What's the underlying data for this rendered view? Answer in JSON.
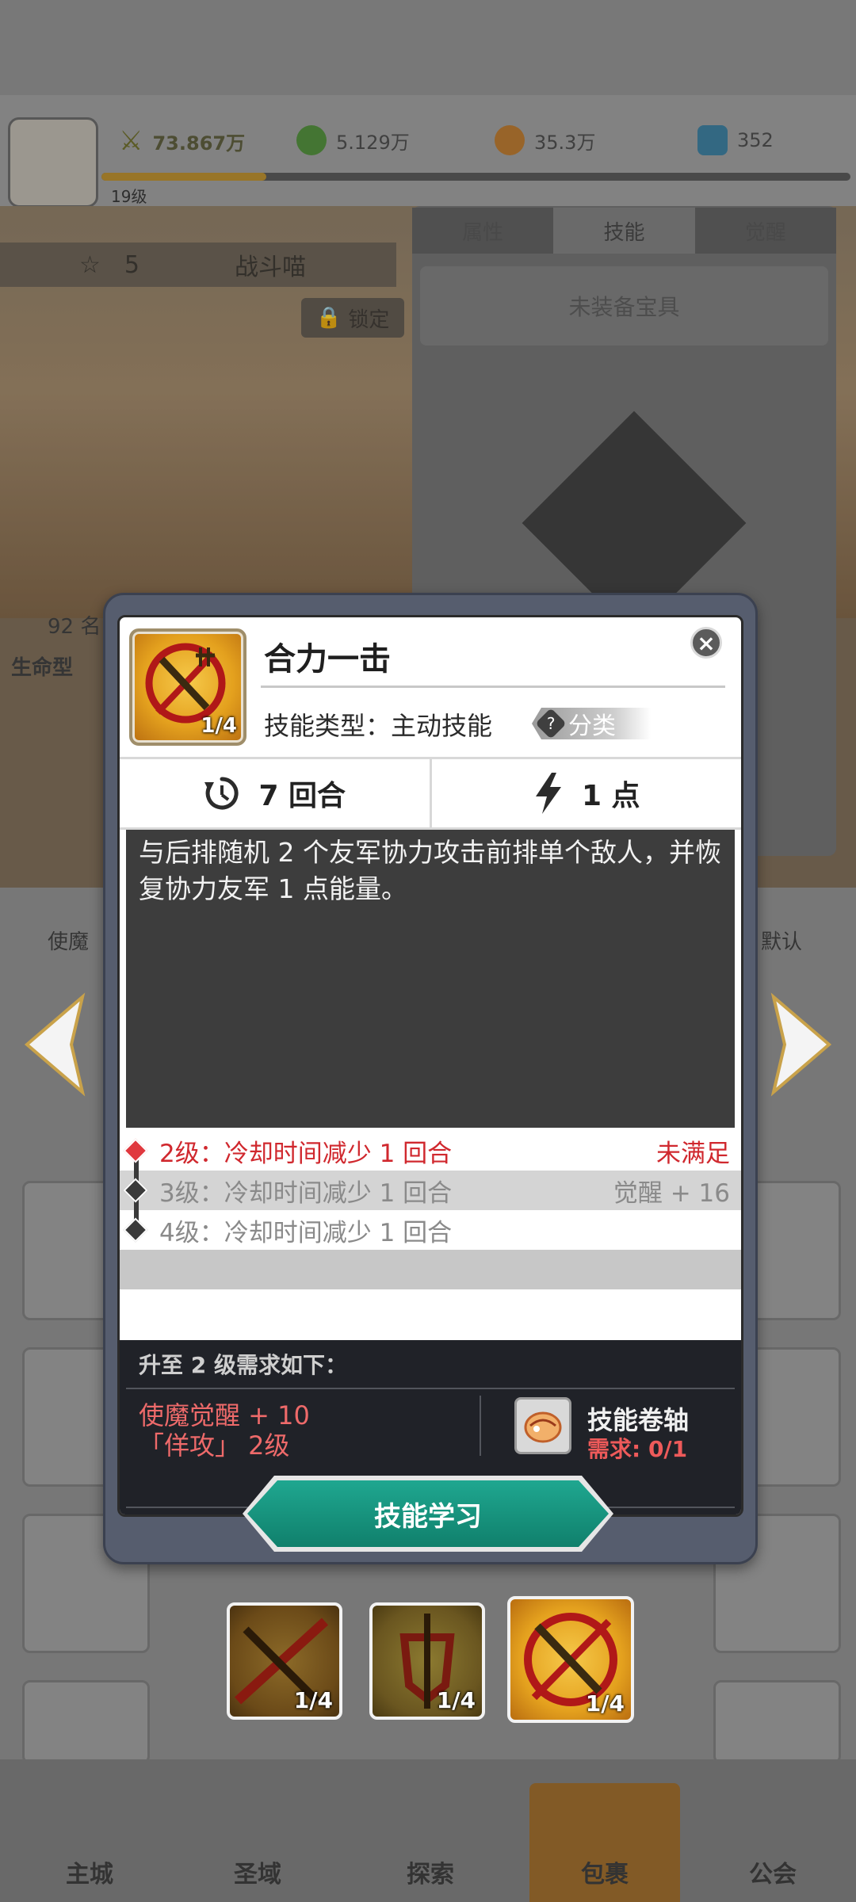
{
  "background": {
    "power": "73.867万",
    "gold": "5.129万",
    "food": "35.3万",
    "gems": "352",
    "player_level": "19级",
    "stars": "5",
    "hero_name": "战斗喵",
    "lock_label": "锁定",
    "tabs": [
      "属性",
      "技能",
      "觉醒"
    ],
    "gear_slot": "未装备宝具",
    "power_short": "92 名",
    "role": "生命型",
    "filter_left": "使魔",
    "filter_right": "默认",
    "nav": [
      "主城",
      "圣域",
      "探索",
      "包裹",
      "公会"
    ]
  },
  "skill": {
    "name": "合力一击",
    "level_fraction": "1/4",
    "type_label": "技能类型：主动技能",
    "category_label": "分类",
    "cooldown": "7 回合",
    "energy": "1 点",
    "description": "与后排随机 2 个友军协力攻击前排单个敌人，并恢复协力友军 1 点能量。",
    "upgrades": [
      {
        "text": "2级：冷却时间减少 1 回合",
        "status": "未满足"
      },
      {
        "text": "3级：冷却时间减少 1 回合",
        "status": "觉醒 + 16"
      },
      {
        "text": "4级：冷却时间减少 1 回合",
        "status": ""
      }
    ]
  },
  "requirements": {
    "title": "升至 2 级需求如下：",
    "conditions": [
      "使魔觉醒 + 10",
      "「佯攻」 2级"
    ],
    "item_name": "技能卷轴",
    "item_need": "需求: 0/1"
  },
  "learn_button": "技能学习",
  "skill_slots": [
    {
      "fraction": "1/4"
    },
    {
      "fraction": "1/4"
    },
    {
      "fraction": "1/4"
    }
  ],
  "colors": {
    "red_text": "#d0282e",
    "teal_button": "#10806c",
    "gold_icon": "#e4a11e"
  }
}
